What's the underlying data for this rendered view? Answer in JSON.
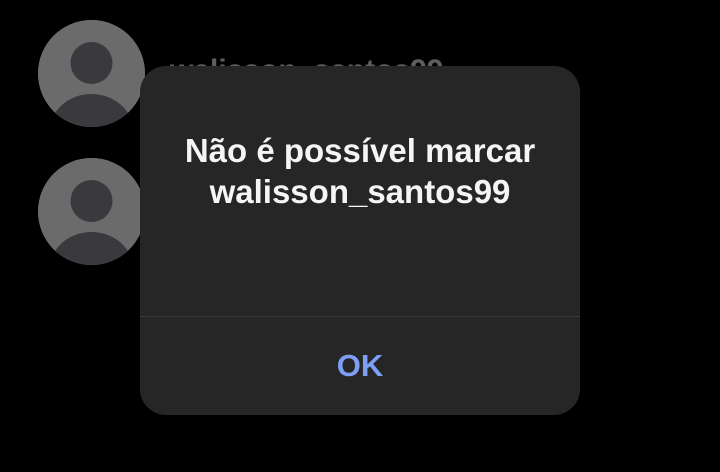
{
  "list": {
    "rows": [
      {
        "avatar_icon": "default-avatar-icon",
        "username": "walisson_santos99"
      },
      {
        "avatar_icon": "default-avatar-icon",
        "username": ""
      }
    ]
  },
  "dialog": {
    "title": "Não é possível marcar walisson_santos99",
    "ok_label": "OK"
  },
  "colors": {
    "background": "#000000",
    "dialog_background": "#262626",
    "avatar_background": "#6b6b6b",
    "avatar_silhouette": "#3a3a3e",
    "title_text": "#f5f5f5",
    "accent": "#7d9ff5"
  }
}
